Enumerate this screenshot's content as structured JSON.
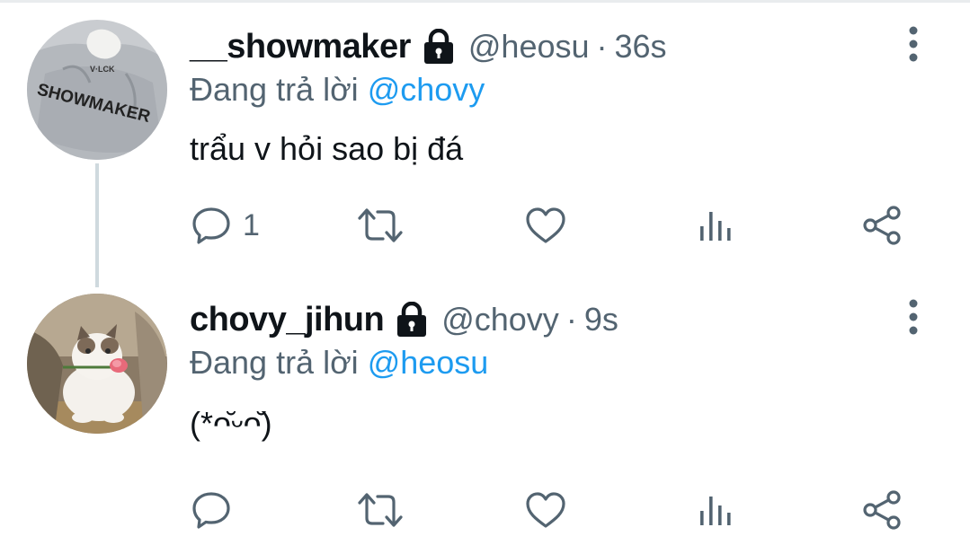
{
  "colors": {
    "accent": "#1d9bf0",
    "secondary_text": "#536471",
    "primary_text": "#0f1419",
    "thread_line": "#cfd9de"
  },
  "tweets": [
    {
      "display_name": "__showmaker",
      "handle": "@heosu",
      "separator": "·",
      "time": "36s",
      "reply_prefix": "Đang trả lời",
      "reply_to": "@chovy",
      "text": "trẩu v hỏi sao bị đá",
      "reply_count": "1",
      "avatar_text": "SHOWMAKER",
      "icons": [
        "lock-icon",
        "more-vertical-icon",
        "reply-icon",
        "retweet-icon",
        "like-icon",
        "views-icon",
        "share-icon"
      ]
    },
    {
      "display_name": "chovy_jihun",
      "handle": "@chovy",
      "separator": "·",
      "time": "9s",
      "reply_prefix": "Đang trả lời",
      "reply_to": "@heosu",
      "text": "(*ᴖ̆ᵕᴖ̆)",
      "reply_count": "",
      "icons": [
        "lock-icon",
        "more-vertical-icon",
        "reply-icon",
        "retweet-icon",
        "like-icon",
        "views-icon",
        "share-icon"
      ]
    }
  ]
}
